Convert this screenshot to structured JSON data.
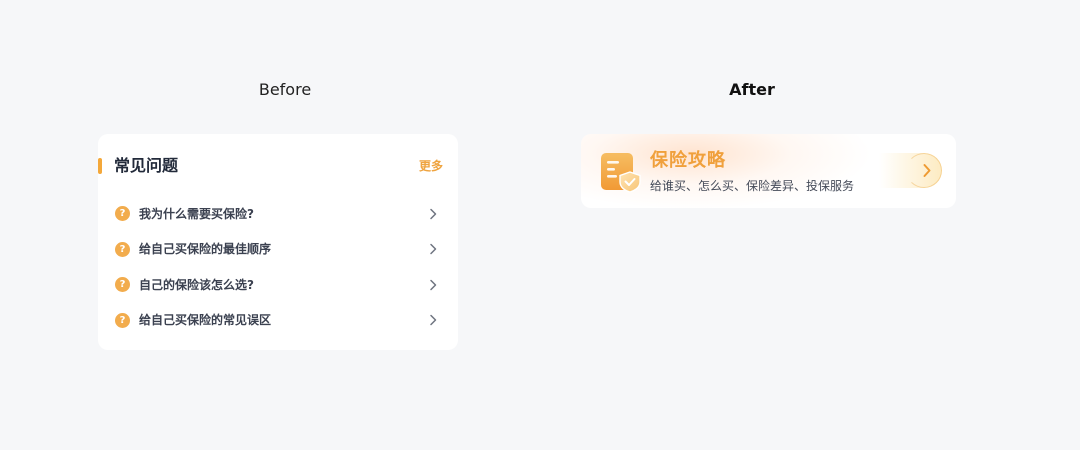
{
  "labels": {
    "before": "Before",
    "after": "After"
  },
  "faq": {
    "title": "常见问题",
    "more": "更多",
    "question_glyph": "?",
    "items": [
      {
        "text": "我为什么需要买保险?"
      },
      {
        "text": "给自己买保险的最佳顺序"
      },
      {
        "text": "自己的保险该怎么选?"
      },
      {
        "text": "给自己买保险的常见误区"
      }
    ],
    "colors": {
      "accent": "#f4a83a",
      "more": "#efa440",
      "question_icon": "#f2ac4d"
    },
    "icons": {
      "question": "question-circle-icon",
      "chevron": "chevron-right-icon"
    }
  },
  "guide": {
    "title": "保险攻略",
    "subtitle": "给谁买、怎么买、保险差异、投保服务",
    "colors": {
      "title": "#f0a03c",
      "icon": "#f3ad48"
    },
    "icons": {
      "main": "document-shield-icon",
      "arrow": "chevron-right-icon"
    }
  }
}
